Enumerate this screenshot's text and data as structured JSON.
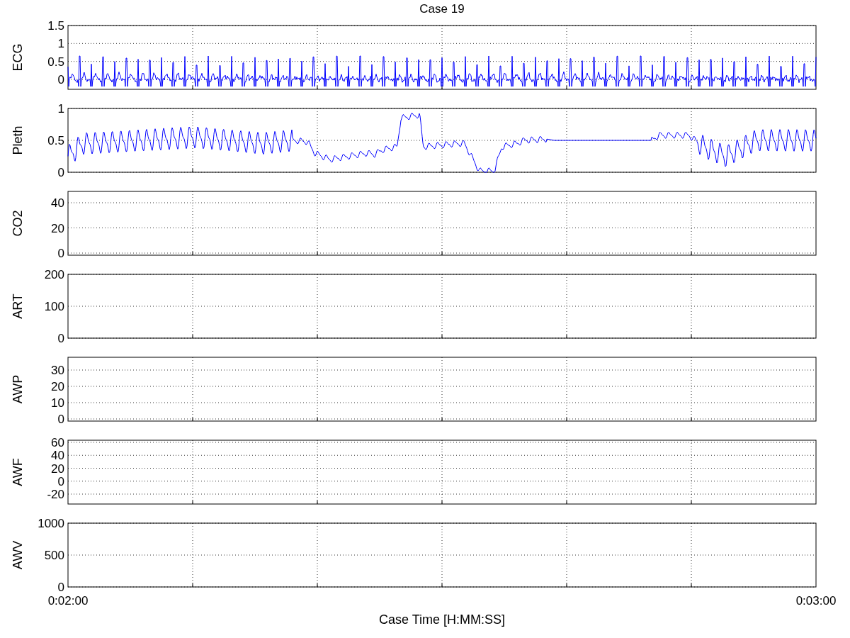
{
  "title": "Case 19",
  "panels": [
    {
      "kind": "ecg",
      "ylabel": "ECG",
      "yticks": [
        "1.5",
        "1",
        "0.5",
        "0"
      ]
    },
    {
      "kind": "pleth",
      "ylabel": "Pleth",
      "yticks": [
        "1",
        "0.5",
        "0"
      ]
    },
    {
      "kind": "empty",
      "ylabel": "CO2",
      "yticks": [
        "40",
        "20",
        "0"
      ]
    },
    {
      "kind": "empty",
      "ylabel": "ART",
      "yticks": [
        "200",
        "100",
        "0"
      ]
    },
    {
      "kind": "empty",
      "ylabel": "AWP",
      "yticks": [
        "30",
        "20",
        "10",
        "0"
      ]
    },
    {
      "kind": "empty",
      "ylabel": "AWF",
      "yticks": [
        "60",
        "40",
        "20",
        "0",
        "-20"
      ]
    },
    {
      "kind": "empty",
      "ylabel": "AWV",
      "yticks": [
        "1000",
        "500",
        "0"
      ]
    }
  ],
  "x_axis": {
    "start_label": "0:02:00",
    "end_label": "0:03:00",
    "xlabel": "Case Time [H:MM:SS]"
  }
}
